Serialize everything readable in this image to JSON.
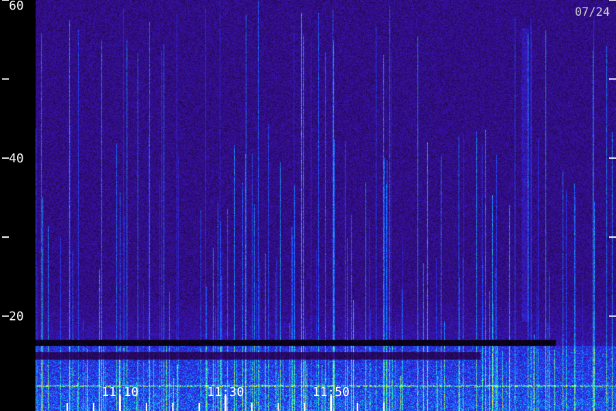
{
  "chart_data": {
    "type": "heatmap",
    "title": "",
    "date_label": "07/24",
    "xlabel": "",
    "ylabel": "",
    "ylim": [
      8,
      60
    ],
    "y_ticks": [
      {
        "value": 60,
        "label": "60"
      },
      {
        "value": 50,
        "label": ""
      },
      {
        "value": 40,
        "label": "40"
      },
      {
        "value": 30,
        "label": ""
      },
      {
        "value": 20,
        "label": "20"
      }
    ],
    "xlim_minutes": [
      -6,
      104
    ],
    "x_ticks": [
      {
        "value": 10,
        "label": "11:10"
      },
      {
        "value": 30,
        "label": "11:30"
      },
      {
        "value": 50,
        "label": "11:50"
      }
    ],
    "x_minor_ticks": [
      0,
      5,
      10,
      15,
      20,
      25,
      30,
      35,
      40,
      45,
      50,
      55,
      60
    ],
    "colormap": [
      "#000000",
      "#2a0a66",
      "#3b14b8",
      "#1e3cff",
      "#14a8ff",
      "#28ffb4",
      "#ffff28"
    ],
    "label_color": "#ffffff"
  }
}
